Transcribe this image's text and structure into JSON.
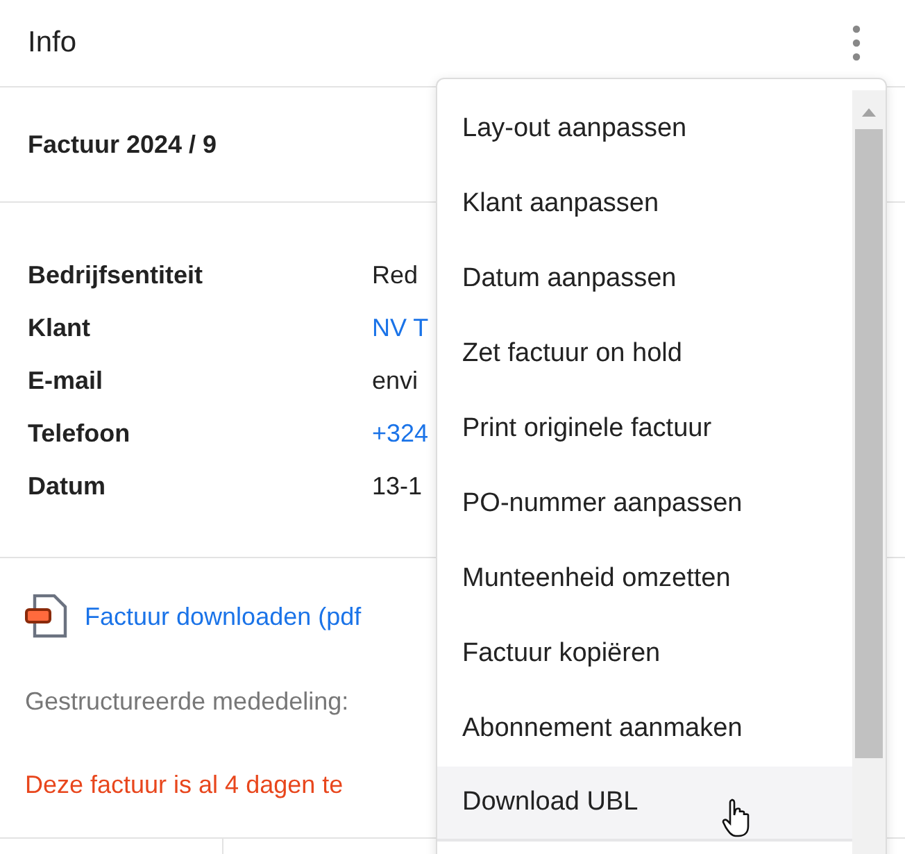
{
  "header": {
    "title": "Info"
  },
  "invoice": {
    "title": "Factuur 2024 / 9"
  },
  "details": [
    {
      "label": "Bedrijfsentiteit",
      "value": "Red",
      "kind": "text"
    },
    {
      "label": "Klant",
      "value": "NV T",
      "kind": "link"
    },
    {
      "label": "E-mail",
      "value": "envi",
      "kind": "text"
    },
    {
      "label": "Telefoon",
      "value": "+324",
      "kind": "link"
    },
    {
      "label": "Datum",
      "value": "13-1",
      "kind": "text"
    }
  ],
  "download": {
    "label": "Factuur downloaden (pdf"
  },
  "structured_message": {
    "label": "Gestructureerde mededeling:"
  },
  "warning": "Deze factuur is al 4 dagen te",
  "menu": {
    "items": [
      {
        "label": "Lay-out aanpassen",
        "highlighted": false
      },
      {
        "label": "Klant aanpassen",
        "highlighted": false
      },
      {
        "label": "Datum aanpassen",
        "highlighted": false
      },
      {
        "label": "Zet factuur on hold",
        "highlighted": false
      },
      {
        "label": "Print originele factuur",
        "highlighted": false
      },
      {
        "label": "PO-nummer aanpassen",
        "highlighted": false
      },
      {
        "label": "Munteenheid omzetten",
        "highlighted": false
      },
      {
        "label": "Factuur kopiëren",
        "highlighted": false
      },
      {
        "label": "Abonnement aanmaken",
        "highlighted": false
      },
      {
        "label": "Download UBL",
        "highlighted": true
      }
    ]
  }
}
